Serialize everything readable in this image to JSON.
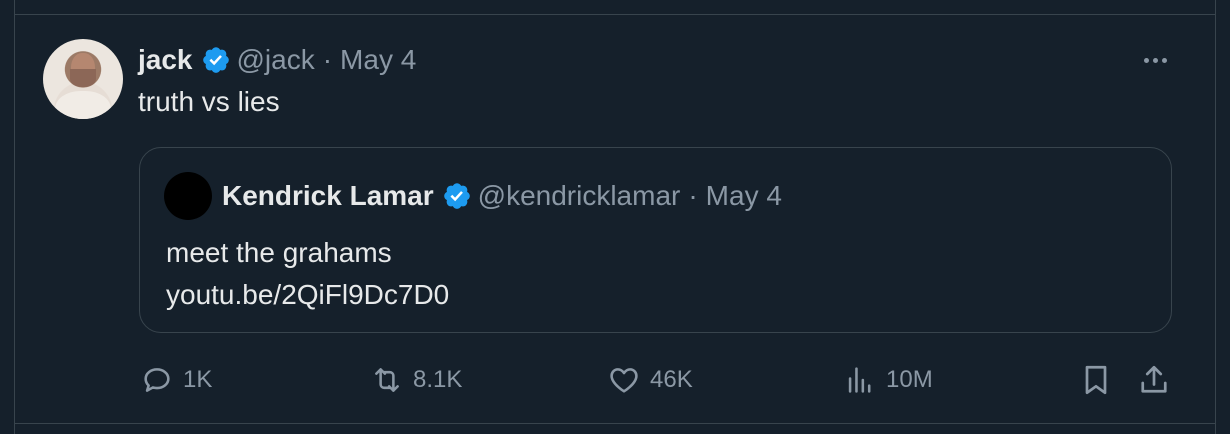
{
  "tweet": {
    "author_name": "jack",
    "author_handle": "@jack",
    "separator": "·",
    "date": "May 4",
    "text": "truth vs lies"
  },
  "quote": {
    "author_name": "Kendrick Lamar",
    "author_handle": "@kendricklamar",
    "separator": "·",
    "date": "May 4",
    "text": "meet the grahams",
    "link": "youtu.be/2QiFl9Dc7D0"
  },
  "actions": {
    "replies": "1K",
    "reposts": "8.1K",
    "likes": "46K",
    "views": "10M"
  },
  "colors": {
    "background": "#15202b",
    "verified": "#1d9bf0",
    "muted": "#8b98a5",
    "text": "#e7e9ea",
    "border": "#38444d"
  },
  "icons": [
    "more-icon",
    "verified-badge-icon",
    "reply-icon",
    "repost-icon",
    "like-icon",
    "views-icon",
    "bookmark-icon",
    "share-icon"
  ]
}
